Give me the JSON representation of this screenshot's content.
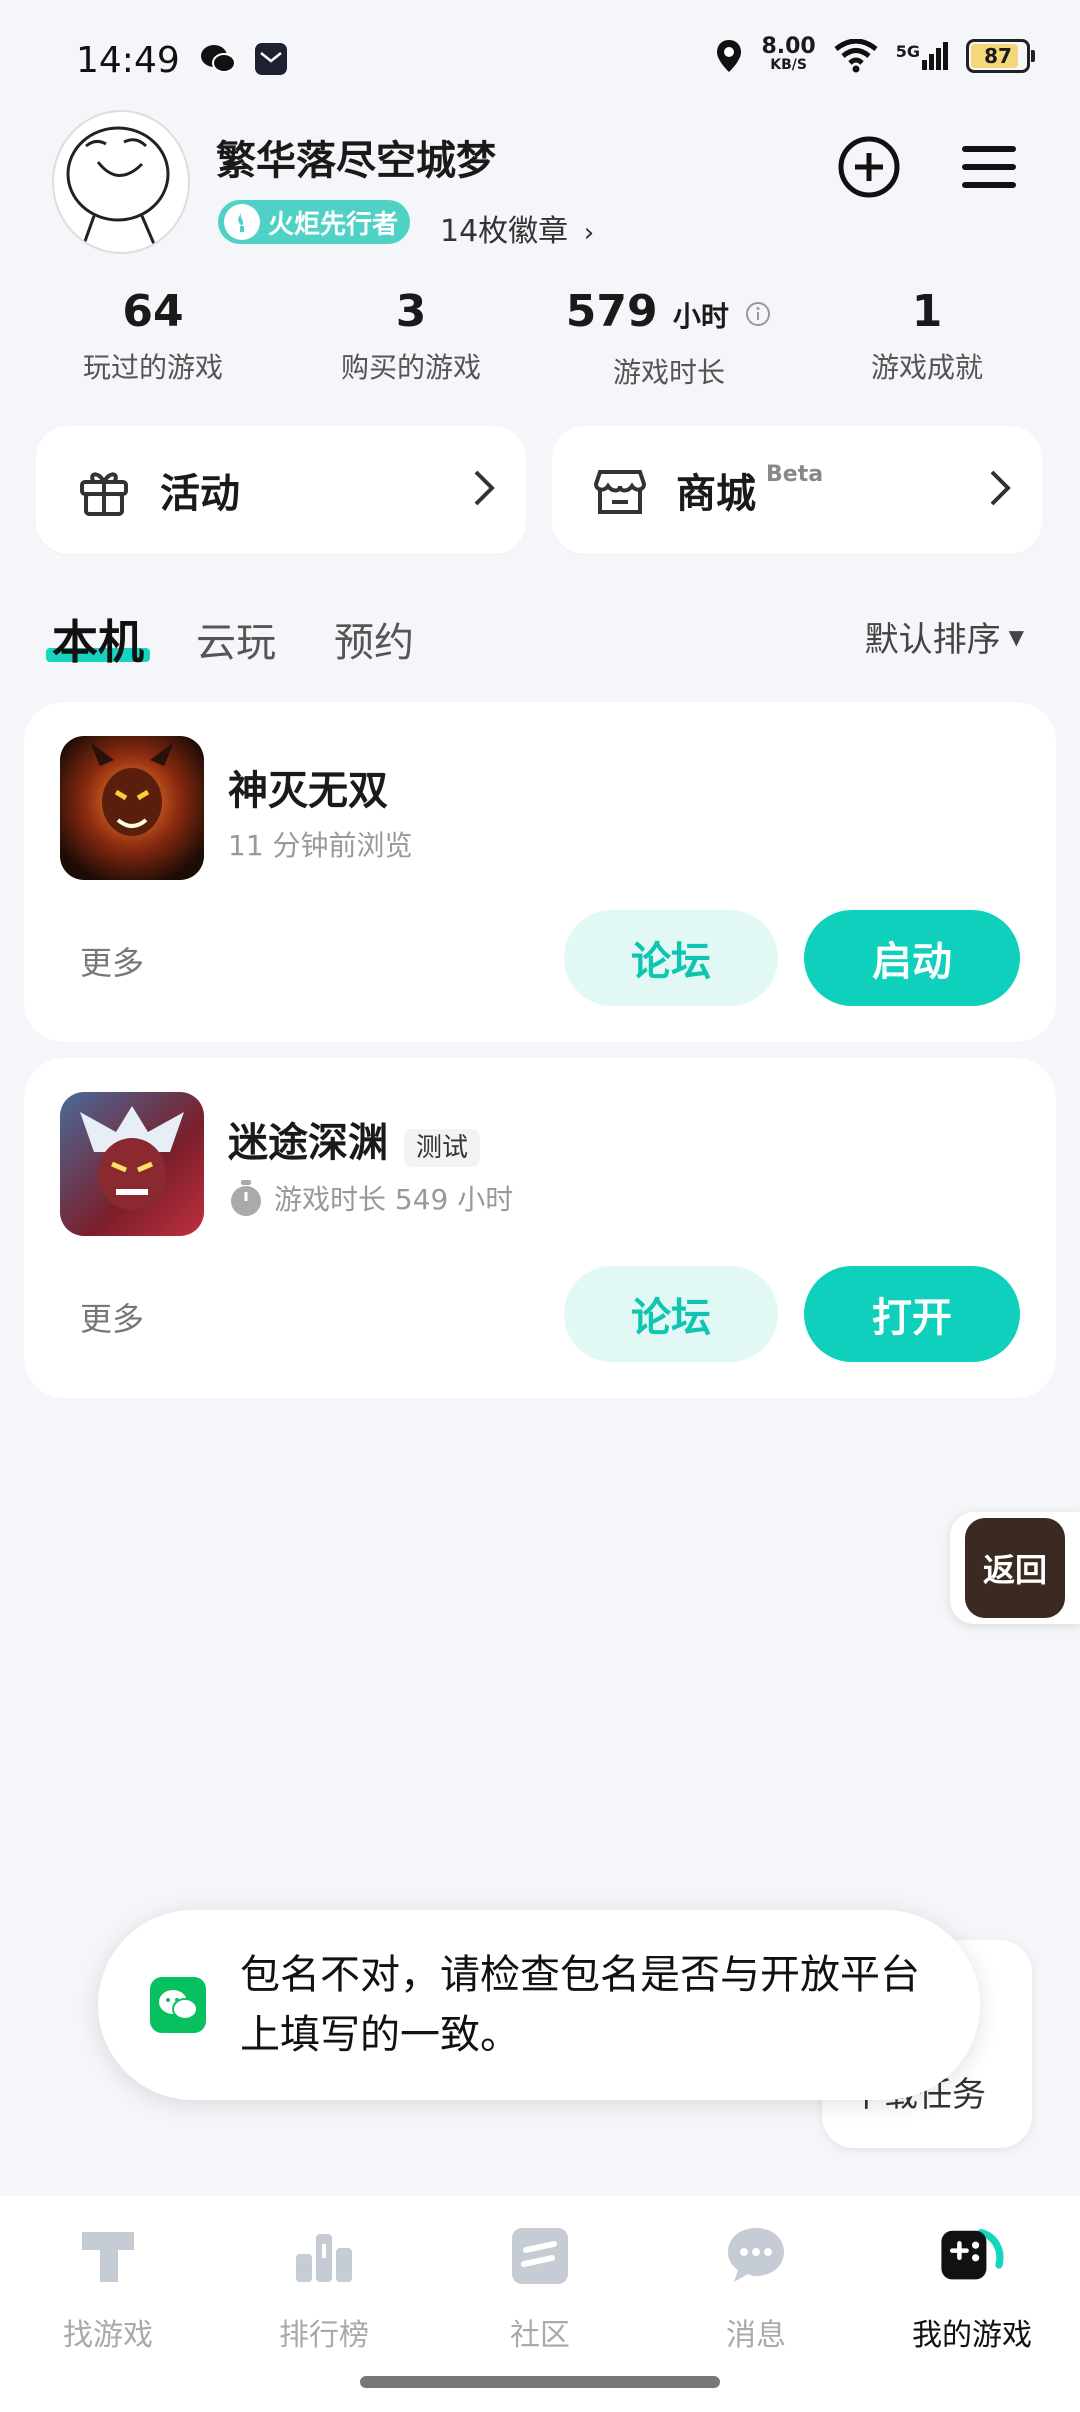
{
  "status_bar": {
    "time": "14:49",
    "net_speed_value": "8.00",
    "net_speed_unit": "KB/S",
    "network": "5G",
    "battery": "87",
    "battery_level": 0.87
  },
  "profile": {
    "username": "繁华落尽空城梦",
    "badge_label": "火炬先行者",
    "badge_count": "14枚徽章",
    "avatar_icon": "doodle-face-avatar"
  },
  "stats": [
    {
      "value": "64",
      "unit": "",
      "label": "玩过的游戏"
    },
    {
      "value": "3",
      "unit": "",
      "label": "购买的游戏"
    },
    {
      "value": "579",
      "unit": "小时",
      "label": "游戏时长"
    },
    {
      "value": "1",
      "unit": "",
      "label": "游戏成就"
    }
  ],
  "quick_cards": [
    {
      "label": "活动",
      "icon": "gift-icon",
      "badge": ""
    },
    {
      "label": "商城",
      "icon": "store-icon",
      "badge": "Beta"
    }
  ],
  "tabs": [
    {
      "label": "本机",
      "active": true
    },
    {
      "label": "云玩",
      "active": false
    },
    {
      "label": "预约",
      "active": false
    }
  ],
  "sort_label": "默认排序",
  "games": [
    {
      "title": "神灭无双",
      "tag": "",
      "subtitle": "11 分钟前浏览",
      "more_label": "更多",
      "forum_label": "论坛",
      "primary_label": "启动"
    },
    {
      "title": "迷途深渊",
      "tag": "测试",
      "subtitle": "游戏时长 549 小时",
      "more_label": "更多",
      "forum_label": "论坛",
      "primary_label": "打开"
    }
  ],
  "float_back_label": "返回",
  "download_task_label": "下载任务",
  "toast_text": "包名不对，请检查包名是否与开放平台上填写的一致。",
  "bottom_nav": [
    {
      "label": "找游戏",
      "icon": "find-game-icon",
      "active": false
    },
    {
      "label": "排行榜",
      "icon": "ranking-icon",
      "active": false
    },
    {
      "label": "社区",
      "icon": "community-icon",
      "active": false
    },
    {
      "label": "消息",
      "icon": "message-icon",
      "active": false
    },
    {
      "label": "我的游戏",
      "icon": "my-games-icon",
      "active": true
    }
  ],
  "colors": {
    "accent": "#0fd0bc",
    "accent_light": "#e1f8f5",
    "background": "#f4f6f9",
    "wechat_green": "#07c160"
  }
}
